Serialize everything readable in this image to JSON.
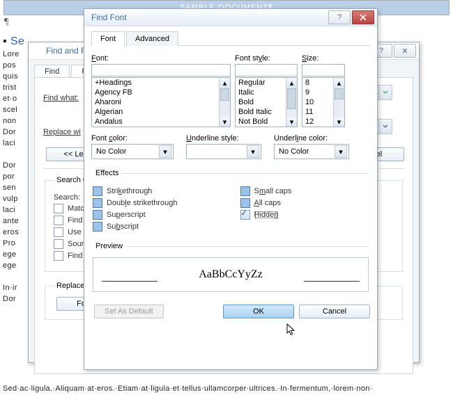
{
  "docHeader": "SAMPLE·DOCUMENT¶",
  "bgParagraph": "Lore\npos\nquis\ntrist\net·o           uris·\nscel           t·\nnon           la.·\nDor           ·in·\nlaci           ne·\n\nDor           nc·\npor           r·\nsen           ·\nvulp           elit·\nlaci           vel·\nante           haracters\neros           haracters\nPro\nege\nege\n\nIn·ir\nDor",
  "bgHead": "¶",
  "blueWord": "Se",
  "bottomText": "Sed·ac·ligula.·Aliquam·at·eros.·Etiam·at·ligula·et·tellus·ullamcorper·ultrices.·In·fermentum,·lorem·non·",
  "findReplace": {
    "title": "Find and Rep",
    "tabs": {
      "find": "Find",
      "replace": "R"
    },
    "findWhatLabel": "Find what:",
    "replaceWithLabel": "Replace wi",
    "lessBtn": "<<  Less",
    "cancelBtn": "ancel",
    "searchOptionsLegend": "Search Opt",
    "searchLabel": "Search:",
    "options": {
      "matchCase": "Matc",
      "findWhole": "Find w",
      "useWildcards": "Use w",
      "soundsLike": "Soun",
      "findAllForms": "Find a"
    },
    "replaceLegend": "Replace",
    "formatBtn": "Forma"
  },
  "findFont": {
    "title": "Find Font",
    "tabs": {
      "font": "Font",
      "advanced": "Advanced"
    },
    "labels": {
      "font": "Font:",
      "fontStyle": "Font style:",
      "size": "Size:",
      "fontColor": "Font color:",
      "underlineStyle": "Underline style:",
      "underlineColor": "Underline color:"
    },
    "fontList": [
      "+Headings",
      "Agency FB",
      "Aharoni",
      "Algerian",
      "Andalus"
    ],
    "styleList": [
      "Regular",
      "Italic",
      "Bold",
      "Bold Italic",
      "Not Bold"
    ],
    "sizeList": [
      "8",
      "9",
      "10",
      "11",
      "12"
    ],
    "noColor": "No Color",
    "effectsLegend": "Effects",
    "effects": {
      "strike": "Strikethrough",
      "dstrike": "Double strikethrough",
      "superscript": "Superscript",
      "subscript": "Subscript",
      "smallcaps": "Small caps",
      "allcaps": "All caps",
      "hidden": "Hidden"
    },
    "previewLegend": "Preview",
    "previewText": "AaBbCcYyZz",
    "setDefault": "Set As Default",
    "ok": "OK",
    "cancel": "Cancel"
  }
}
